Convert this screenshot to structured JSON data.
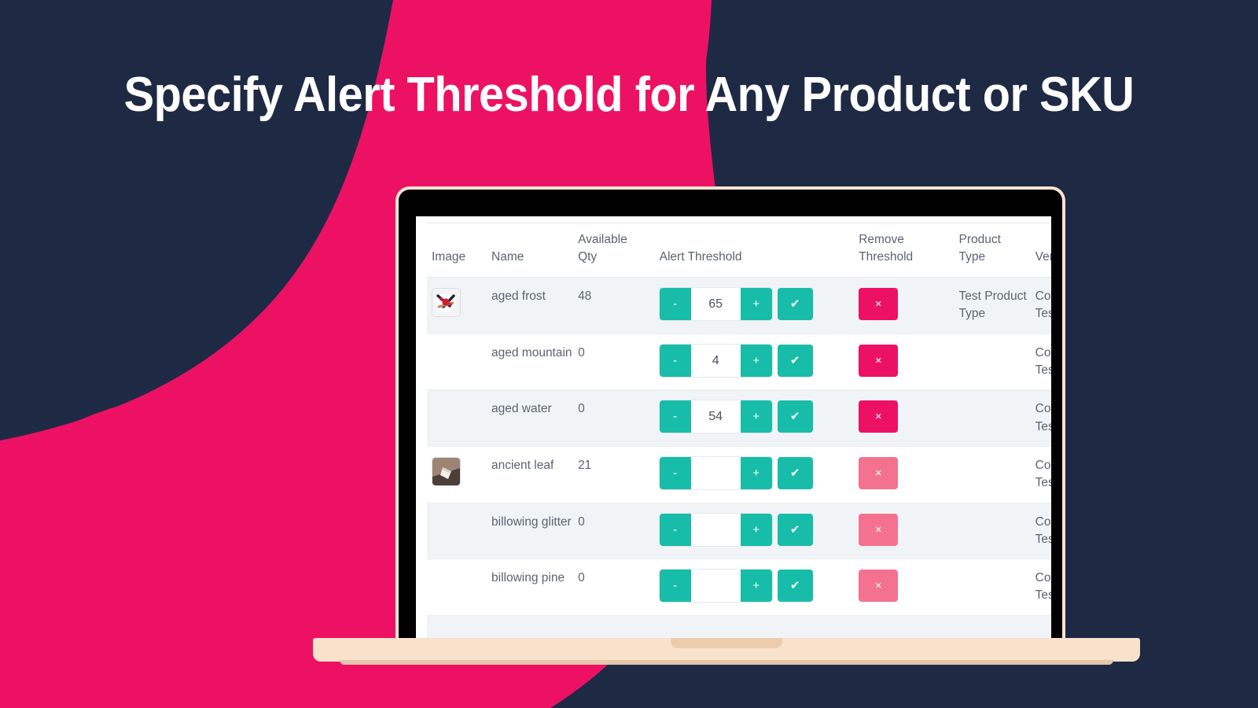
{
  "headline": "Specify Alert Threshold for Any Product or SKU",
  "colors": {
    "background_navy": "#1E2A44",
    "accent_pink": "#ED1164",
    "accent_pink_disabled": "#F4728F",
    "accent_teal": "#17BDA8",
    "laptop_base": "#F8E2CC",
    "row_stripe": "#F1F4F7"
  },
  "table": {
    "headers": {
      "image": "Image",
      "name": "Name",
      "available_qty_line1": "Available",
      "available_qty_line2": "Qty",
      "alert_threshold": "Alert Threshold",
      "remove_threshold_line1": "Remove",
      "remove_threshold_line2": "Threshold",
      "product_type_line1": "Product",
      "product_type_line2": "Type",
      "vendor": "Ven"
    },
    "controls": {
      "minus_label": "-",
      "plus_label": "+",
      "confirm_label": "✔",
      "remove_label": "×",
      "threshold_placeholder": ""
    },
    "rows": [
      {
        "has_image": true,
        "image_icon": "product-thumbnail-red",
        "name": "aged frost",
        "qty": "48",
        "threshold": "65",
        "remove_enabled": true,
        "product_type": "Test Product Type",
        "vendor_line1": "Cor",
        "vendor_line2": "Tes"
      },
      {
        "has_image": false,
        "image_icon": "",
        "name": "aged mountain",
        "qty": "0",
        "threshold": "4",
        "remove_enabled": true,
        "product_type": "",
        "vendor_line1": "Cor",
        "vendor_line2": "Tes"
      },
      {
        "has_image": false,
        "image_icon": "",
        "name": "aged water",
        "qty": "0",
        "threshold": "54",
        "remove_enabled": true,
        "product_type": "",
        "vendor_line1": "Cor",
        "vendor_line2": "Tes"
      },
      {
        "has_image": true,
        "image_icon": "product-thumbnail-tan",
        "name": "ancient leaf",
        "qty": "21",
        "threshold": "",
        "remove_enabled": false,
        "product_type": "",
        "vendor_line1": "Cor",
        "vendor_line2": "Tes"
      },
      {
        "has_image": false,
        "image_icon": "",
        "name": "billowing glitter",
        "qty": "0",
        "threshold": "",
        "remove_enabled": false,
        "product_type": "",
        "vendor_line1": "Cor",
        "vendor_line2": "Tes"
      },
      {
        "has_image": false,
        "image_icon": "",
        "name": "billowing pine",
        "qty": "0",
        "threshold": "",
        "remove_enabled": false,
        "product_type": "",
        "vendor_line1": "Cor",
        "vendor_line2": "Tes"
      }
    ]
  }
}
